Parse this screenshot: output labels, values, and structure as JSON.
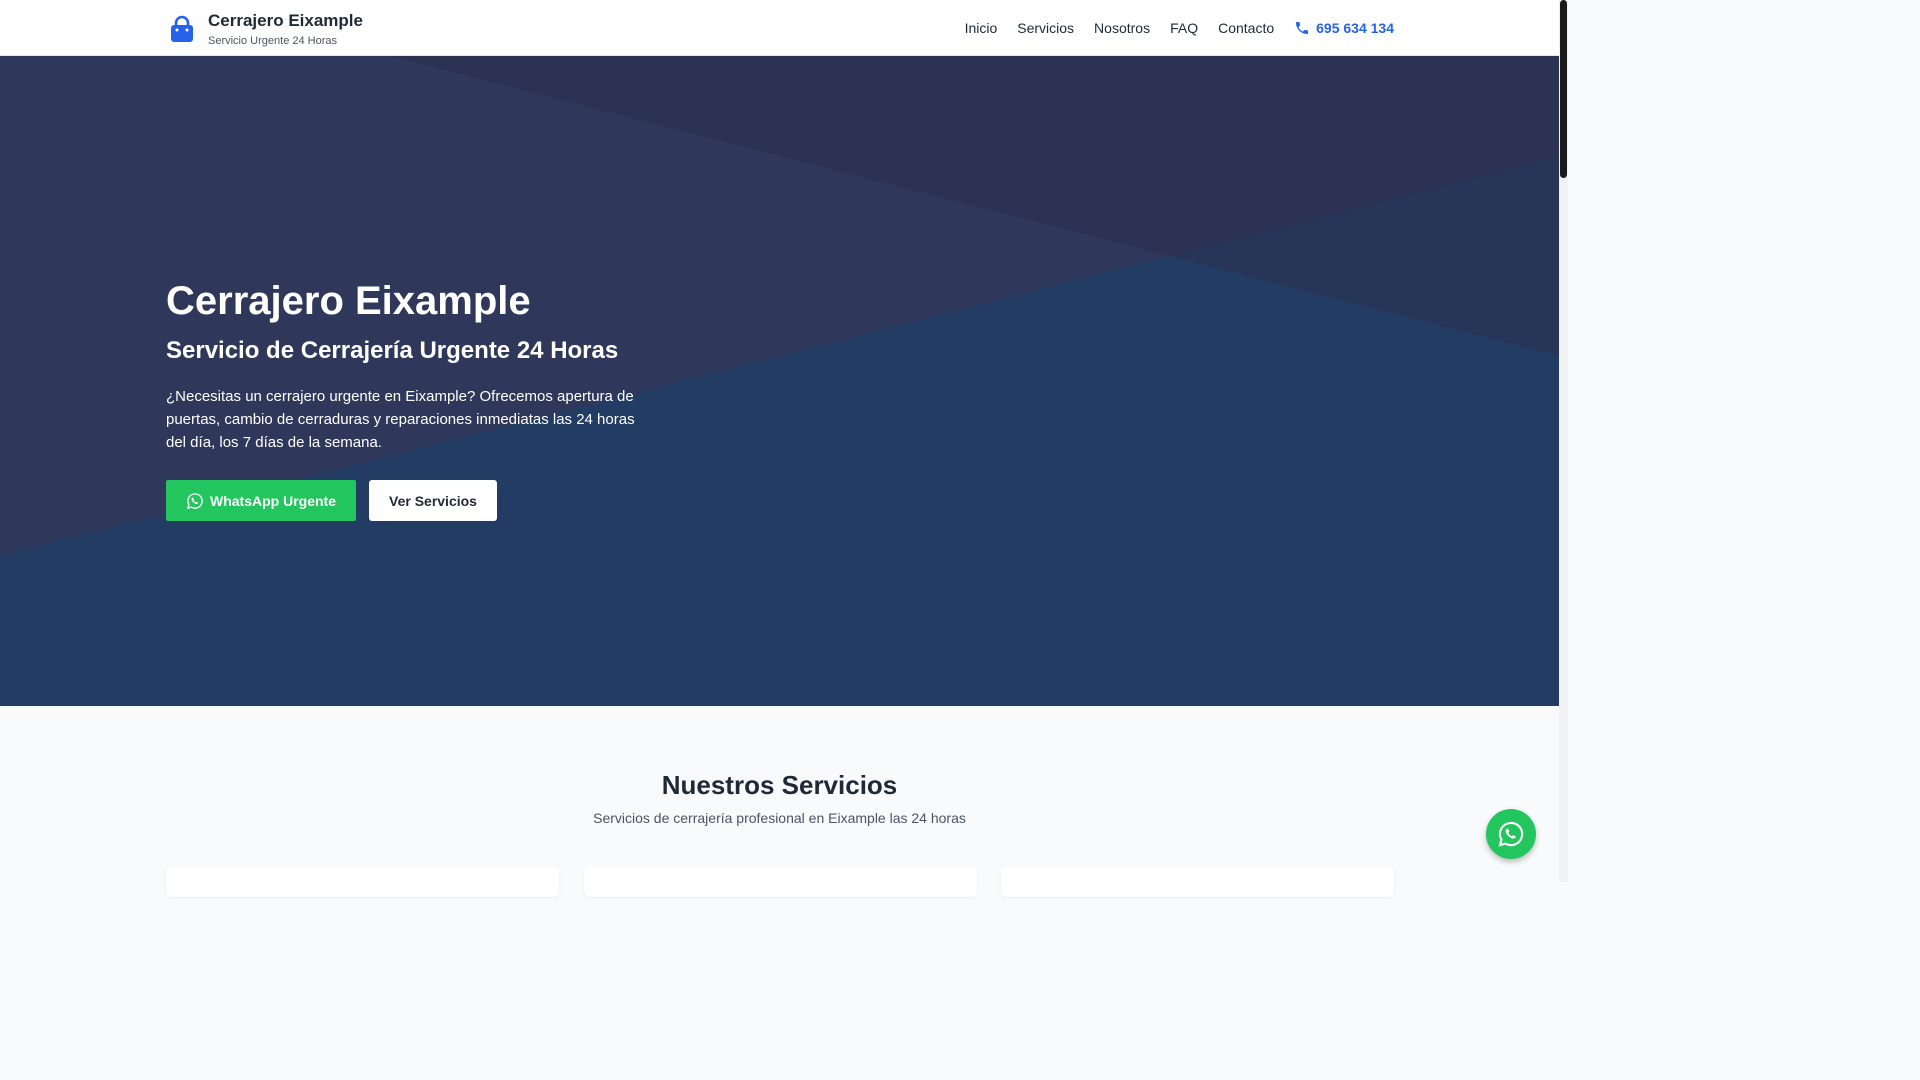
{
  "header": {
    "brand_title": "Cerrajero Eixample",
    "brand_subtitle": "Servicio Urgente 24 Horas",
    "nav": [
      "Inicio",
      "Servicios",
      "Nosotros",
      "FAQ",
      "Contacto"
    ],
    "phone": "695 634 134"
  },
  "hero": {
    "title": "Cerrajero Eixample",
    "subtitle": "Servicio de Cerrajería Urgente 24 Horas",
    "description": "¿Necesitas un cerrajero urgente en Eixample? Ofrecemos apertura de puertas, cambio de cerraduras y reparaciones inmediatas las 24 horas del día, los 7 días de la semana.",
    "whatsapp_button": "WhatsApp Urgente",
    "services_button": "Ver Servicios"
  },
  "services": {
    "title": "Nuestros Servicios",
    "subtitle": "Servicios de cerrajería profesional en Eixample las 24 horas"
  },
  "colors": {
    "accent": "#2563eb",
    "whatsapp": "#22c55e",
    "hero_bg": "#223c63"
  },
  "icons": {
    "brand": "lock-icon",
    "phone": "phone-icon",
    "whatsapp": "whatsapp-icon"
  }
}
